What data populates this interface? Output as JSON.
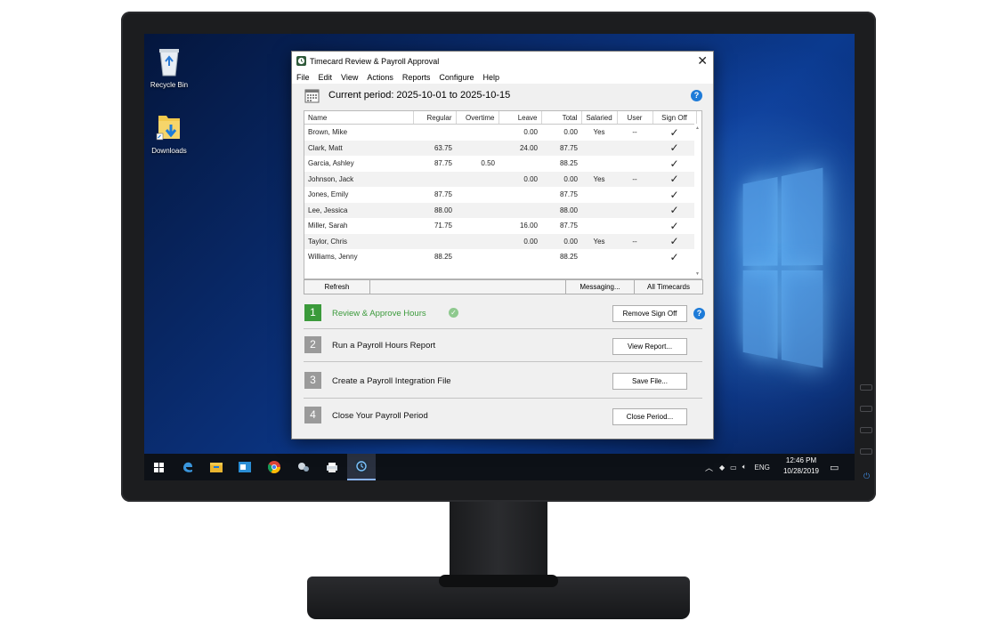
{
  "desktop": {
    "icons": [
      {
        "label": "Recycle Bin"
      },
      {
        "label": "Downloads"
      }
    ]
  },
  "window": {
    "title": "Timecard Review & Payroll Approval",
    "menu": [
      "File",
      "Edit",
      "View",
      "Actions",
      "Reports",
      "Configure",
      "Help"
    ],
    "period_text": "Current period: 2025-10-01 to 2025-10-15"
  },
  "table": {
    "columns": [
      "Name",
      "Regular",
      "Overtime",
      "Leave",
      "Total",
      "Salaried",
      "User",
      "Sign Off"
    ],
    "rows": [
      {
        "name": "Brown, Mike",
        "regular": "",
        "overtime": "",
        "leave": "0.00",
        "total": "0.00",
        "salaried": "Yes",
        "user": "--",
        "signoff": "✓"
      },
      {
        "name": "Clark, Matt",
        "regular": "63.75",
        "overtime": "",
        "leave": "24.00",
        "total": "87.75",
        "salaried": "",
        "user": "",
        "signoff": "✓"
      },
      {
        "name": "Garcia, Ashley",
        "regular": "87.75",
        "overtime": "0.50",
        "leave": "",
        "total": "88.25",
        "salaried": "",
        "user": "",
        "signoff": "✓"
      },
      {
        "name": "Johnson, Jack",
        "regular": "",
        "overtime": "",
        "leave": "0.00",
        "total": "0.00",
        "salaried": "Yes",
        "user": "--",
        "signoff": "✓"
      },
      {
        "name": "Jones, Emily",
        "regular": "87.75",
        "overtime": "",
        "leave": "",
        "total": "87.75",
        "salaried": "",
        "user": "",
        "signoff": "✓"
      },
      {
        "name": "Lee, Jessica",
        "regular": "88.00",
        "overtime": "",
        "leave": "",
        "total": "88.00",
        "salaried": "",
        "user": "",
        "signoff": "✓"
      },
      {
        "name": "Miller, Sarah",
        "regular": "71.75",
        "overtime": "",
        "leave": "16.00",
        "total": "87.75",
        "salaried": "",
        "user": "",
        "signoff": "✓"
      },
      {
        "name": "Taylor, Chris",
        "regular": "",
        "overtime": "",
        "leave": "0.00",
        "total": "0.00",
        "salaried": "Yes",
        "user": "--",
        "signoff": "✓"
      },
      {
        "name": "Williams, Jenny",
        "regular": "88.25",
        "overtime": "",
        "leave": "",
        "total": "88.25",
        "salaried": "",
        "user": "",
        "signoff": "✓"
      }
    ]
  },
  "buttons": {
    "refresh": "Refresh",
    "messaging": "Messaging...",
    "all_timecards": "All Timecards"
  },
  "steps": [
    {
      "number": "1",
      "label": "Review & Approve Hours",
      "button": "Remove Sign Off",
      "done": true
    },
    {
      "number": "2",
      "label": "Run a Payroll Hours Report",
      "button": "View Report...",
      "done": false
    },
    {
      "number": "3",
      "label": "Create a Payroll Integration File",
      "button": "Save File...",
      "done": false
    },
    {
      "number": "4",
      "label": "Close Your Payroll Period",
      "button": "Close Period...",
      "done": false
    }
  ],
  "taskbar": {
    "language": "ENG",
    "time": "12:46 PM",
    "date": "10/28/2019"
  },
  "colors": {
    "accent_blue": "#1e7bd8",
    "step_done_green": "#3b9a3b",
    "check_green": "#1a8a1a",
    "desktop_blue": "#0a2e74"
  }
}
